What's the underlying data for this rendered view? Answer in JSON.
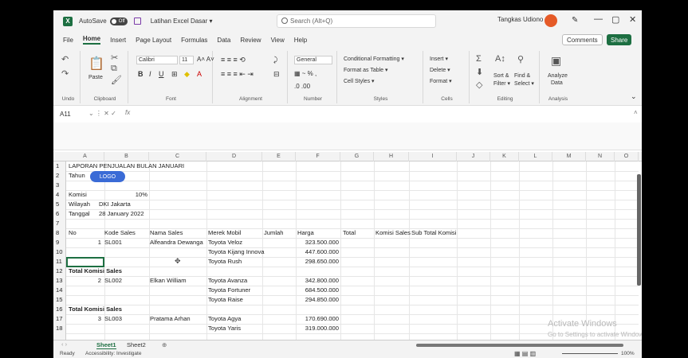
{
  "titlebar": {
    "app_logo": "X",
    "autosave_label": "AutoSave",
    "autosave_state": "Off",
    "doc_title": "Latihan Excel Dasar ▾",
    "search_placeholder": "Search (Alt+Q)",
    "user_name": "Tangkas Udiono",
    "minimize": "—",
    "restore": "▢",
    "close": "✕"
  },
  "menu": {
    "tabs": [
      "File",
      "Home",
      "Insert",
      "Page Layout",
      "Formulas",
      "Data",
      "Review",
      "View",
      "Help"
    ],
    "active": "Home",
    "comments": "Comments",
    "share": "Share"
  },
  "ribbon": {
    "undo_label": "Undo",
    "clipboard_label": "Clipboard",
    "paste": "Paste",
    "font_label": "Font",
    "font_name": "Calibri",
    "font_size": "11",
    "alignment_label": "Alignment",
    "number_label": "Number",
    "number_format": "General",
    "styles_label": "Styles",
    "conditional_formatting": "Conditional Formatting ▾",
    "format_as_table": "Format as Table ▾",
    "cell_styles": "Cell Styles ▾",
    "cells_label": "Cells",
    "insert": "Insert ▾",
    "delete": "Delete ▾",
    "format": "Format ▾",
    "editing_label": "Editing",
    "sort_filter": "Sort &",
    "sort_filter2": "Filter ▾",
    "find_select": "Find &",
    "find_select2": "Select ▾",
    "analysis_label": "Analysis",
    "analyze_data": "Analyze",
    "analyze_data2": "Data"
  },
  "formula": {
    "name_box": "A11",
    "fx": "fx"
  },
  "grid": {
    "columns": [
      "A",
      "B",
      "C",
      "D",
      "E",
      "F",
      "G",
      "H",
      "I",
      "J",
      "K",
      "L",
      "M",
      "N",
      "O"
    ],
    "rows": [
      "1",
      "2",
      "3",
      "4",
      "5",
      "6",
      "7",
      "8",
      "9",
      "10",
      "11",
      "12",
      "13",
      "14",
      "15",
      "16",
      "17",
      "18"
    ],
    "logo": "LOGO",
    "cells": {
      "r1": "LAPORAN PENJUALAN BULAN JANUARI",
      "r2": "Tahun",
      "r4a": "Komisi",
      "r4b": "10%",
      "r5a": "Wilayah",
      "r5b": "DKI Jakarta",
      "r6a": "Tanggal",
      "r6b": "28 January 2022",
      "h_no": "No",
      "h_kode": "Kode Sales",
      "h_nama": "Nama Sales",
      "h_merek": "Merek Mobil",
      "h_jumlah": "Jumlah",
      "h_harga": "Harga",
      "h_total": "Total",
      "h_komisi": "Komisi Sales",
      "h_subtotal": "Sub Total Komisi",
      "r9_no": "1",
      "r9_kode": "SL001",
      "r9_nama": "Alfeandra Dewanga",
      "r9_merek": "Toyota Veloz",
      "r9_harga": "323.500.000",
      "r10_merek": "Toyota Kijang Innova",
      "r10_harga": "447.600.000",
      "r11_merek": "Toyota Rush",
      "r11_harga": "298.650.000",
      "r12": "Total Komisi Sales",
      "r13_no": "2",
      "r13_kode": "SL002",
      "r13_nama": "Elkan William",
      "r13_merek": "Toyota Avanza",
      "r13_harga": "342.800.000",
      "r14_merek": "Toyota Fortuner",
      "r14_harga": "684.500.000",
      "r15_merek": "Toyota Raise",
      "r15_harga": "294.850.000",
      "r16": "Total Komisi Sales",
      "r17_no": "3",
      "r17_kode": "SL003",
      "r17_nama": "Pratama Arhan",
      "r17_merek": "Toyota Agya",
      "r17_harga": "170.690.000",
      "r18_merek": "Toyota Yaris",
      "r18_harga": "319.000.000"
    }
  },
  "sheets": {
    "tabs": [
      "Sheet1",
      "Sheet2"
    ],
    "active": "Sheet1",
    "add": "⊕"
  },
  "status": {
    "ready": "Ready",
    "accessibility": "Accessibility: Investigate",
    "zoom": "100%"
  },
  "watermark": {
    "title": "Activate Windows",
    "sub": "Go to Settings to activate Windows."
  },
  "colors": {
    "excel_green": "#1d6f42",
    "logo_blue": "#3a6bd6",
    "avatar": "#e55a27"
  }
}
